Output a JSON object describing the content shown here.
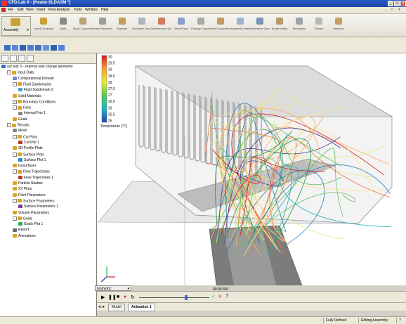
{
  "window": {
    "title": "CFD.Lab II - [Heater.SLDASM *]"
  },
  "menu": [
    "File",
    "Edit",
    "View",
    "Insert",
    "Flow Analysis",
    "Tools",
    "Window",
    "Help"
  ],
  "toolbar": {
    "assembly_label": "Assembly",
    "buttons": [
      "Insert Components",
      "Mate",
      "Move Component",
      "Smart Fasteners",
      "Explode",
      "Exploded Line Sketch",
      "Interference Detection",
      "Hide/Show",
      "Change Suppression",
      "Edit Component",
      "Assembly Features",
      "Reference Geometry",
      "Smart Mates",
      "Simulation",
      "Sketch",
      "Features"
    ]
  },
  "tree": [
    {
      "label": "our test 3 - external task change geometry",
      "level": 0,
      "icon": "project-icon",
      "color": "#3b6cc7"
    },
    {
      "label": "Input Data",
      "level": 1,
      "icon": "folder-icon",
      "color": "#d9a520",
      "expander": "-"
    },
    {
      "label": "Computational Domain",
      "level": 2,
      "icon": "domain-icon",
      "color": "#6c8cc9"
    },
    {
      "label": "Fluid Subdomains",
      "level": 2,
      "icon": "folder-icon",
      "color": "#d9a520",
      "expander": "-"
    },
    {
      "label": "Fluid Subdomain 2",
      "level": 3,
      "icon": "fluid-icon",
      "color": "#4fa0d8"
    },
    {
      "label": "Solid Materials",
      "level": 2,
      "icon": "folder-icon",
      "color": "#d9a520"
    },
    {
      "label": "Boundary Conditions",
      "level": 2,
      "icon": "folder-icon",
      "color": "#d9a520",
      "expander": "+"
    },
    {
      "label": "Fans",
      "level": 2,
      "icon": "folder-icon",
      "color": "#d9a520",
      "expander": "-"
    },
    {
      "label": "Internal Fan 1",
      "level": 3,
      "icon": "fan-icon",
      "color": "#888888"
    },
    {
      "label": "Goals",
      "level": 2,
      "icon": "folder-icon",
      "color": "#d9a520"
    },
    {
      "label": "Results",
      "level": 1,
      "icon": "folder-icon",
      "color": "#d9a520",
      "expander": "-"
    },
    {
      "label": "Mesh",
      "level": 2,
      "icon": "mesh-icon",
      "color": "#888888"
    },
    {
      "label": "Cut Plots",
      "level": 2,
      "icon": "folder-icon",
      "color": "#d9a520",
      "expander": "-"
    },
    {
      "label": "Cut Plot 1",
      "level": 3,
      "icon": "cutplot-icon",
      "color": "#c0392b"
    },
    {
      "label": "3D-Profile Plots",
      "level": 2,
      "icon": "folder-icon",
      "color": "#d9a520"
    },
    {
      "label": "Surface Plots",
      "level": 2,
      "icon": "folder-icon",
      "color": "#d9a520",
      "expander": "-"
    },
    {
      "label": "Surface Plot 1",
      "level": 3,
      "icon": "surfaceplot-icon",
      "color": "#2e86c1"
    },
    {
      "label": "Isosurfaces",
      "level": 2,
      "icon": "folder-icon",
      "color": "#d9a520"
    },
    {
      "label": "Flow Trajectories",
      "level": 2,
      "icon": "folder-icon",
      "color": "#d9a520",
      "expander": "-"
    },
    {
      "label": "Flow Trajectories 1",
      "level": 3,
      "icon": "trajectory-icon",
      "color": "#c0392b"
    },
    {
      "label": "Particle Studies",
      "level": 2,
      "icon": "folder-icon",
      "color": "#d9a520"
    },
    {
      "label": "XY Plots",
      "level": 2,
      "icon": "folder-icon",
      "color": "#d9a520"
    },
    {
      "label": "Point Parameters",
      "level": 2,
      "icon": "folder-icon",
      "color": "#d9a520"
    },
    {
      "label": "Surface Parameters",
      "level": 2,
      "icon": "folder-icon",
      "color": "#d9a520",
      "expander": "-"
    },
    {
      "label": "Surface Parameters 1",
      "level": 3,
      "icon": "parameter-icon",
      "color": "#7d3c98"
    },
    {
      "label": "Volume Parameters",
      "level": 2,
      "icon": "folder-icon",
      "color": "#d9a520"
    },
    {
      "label": "Goals",
      "level": 2,
      "icon": "folder-icon",
      "color": "#d9a520",
      "expander": "-"
    },
    {
      "label": "Goals Plot 1",
      "level": 3,
      "icon": "goalplot-icon",
      "color": "#27ae60"
    },
    {
      "label": "Report",
      "level": 2,
      "icon": "report-icon",
      "color": "#5d6d7e"
    },
    {
      "label": "Animations",
      "level": 2,
      "icon": "animation-icon",
      "color": "#d9a520"
    }
  ],
  "legend": {
    "title": "Temperature [°C]",
    "ticks": [
      "30",
      "29.5",
      "29",
      "28.5",
      "28",
      "27.5",
      "27",
      "26.5",
      "26",
      "25.5",
      "25"
    ],
    "colors": [
      "#d7191c",
      "#f46d43",
      "#fdae61",
      "#fee08b",
      "#d9ef8b",
      "#66bd63",
      "#1a9850",
      "#22b0b0",
      "#2c7bb6",
      "#313695"
    ]
  },
  "view": {
    "orientation": "Isometric"
  },
  "animation": {
    "time": "00:00.360",
    "help": "?"
  },
  "tabs": [
    "Model",
    "Animation 1"
  ],
  "status": {
    "defined": "Fully Defined",
    "mode": "Editing Assembly"
  },
  "icons": {
    "app": "cfd-app-icon",
    "play": "play-icon",
    "pause": "pause-icon",
    "stop": "stop-icon",
    "record": "record-icon",
    "loop": "loop-icon",
    "check": "check-icon",
    "close": "close-icon"
  }
}
